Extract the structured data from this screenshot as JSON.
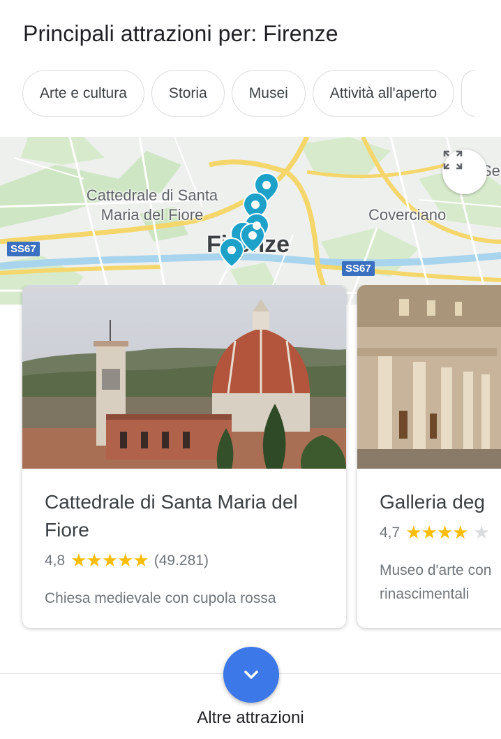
{
  "header": {
    "title": "Principali attrazioni per: Firenze"
  },
  "chips": [
    {
      "label": "Arte e cultura"
    },
    {
      "label": "Storia"
    },
    {
      "label": "Musei"
    },
    {
      "label": "Attività all'aperto"
    }
  ],
  "map": {
    "labels": {
      "cathedral": "Cattedrale di Santa Maria del Fiore",
      "cathedral_line1": "Cattedrale di Santa",
      "cathedral_line2": "Maria del Fiore",
      "coverciano": "Coverciano",
      "city": "Firenze",
      "settignano_partial": "Se"
    },
    "road_badges": [
      "SS67",
      "SS67"
    ],
    "expand_icon": "fullscreen-icon",
    "pin_color": "#1ea1c9"
  },
  "cards": [
    {
      "title": "Cattedrale di Santa Maria del Fiore",
      "rating": "4,8",
      "stars": "★★★★★",
      "reviews": "(49.281)",
      "description": "Chiesa medievale con cupola rossa"
    },
    {
      "title": "Galleria deg",
      "rating": "4,7",
      "stars": "★★★★",
      "description_line1": "Museo d'arte con",
      "description_line2": "rinascimentali"
    }
  ],
  "footer": {
    "more_label": "Altre attrazioni",
    "more_icon": "chevron-down-icon"
  },
  "colors": {
    "star": "#fbbc04",
    "accent_button": "#3c78e8"
  }
}
